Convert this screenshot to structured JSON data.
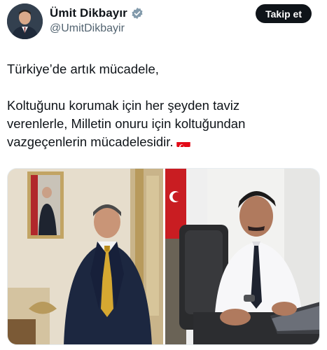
{
  "author": {
    "name": "Ümit Dikbayır",
    "handle": "@UmitDikbayir",
    "verified": true
  },
  "actions": {
    "follow_label": "Takip et"
  },
  "tweet": {
    "line1": "Türkiye’de artık mücadele,",
    "line2": "Koltuğunu korumak için her şeyden taviz",
    "line3": "verenlerle, Milletin onuru için koltuğundan",
    "line4": "vazgeçenlerin mücadelesidir.",
    "emoji": "turkey-flag"
  },
  "media": {
    "count": 2,
    "photos": [
      "man-in-suit-in-ornate-office-photo",
      "man-at-desk-with-laptop-photo"
    ]
  },
  "colors": {
    "follow_button_bg": "#0f1419",
    "verified_badge": "#829aab",
    "handle_text": "#536471",
    "flag_red": "#e30a17"
  }
}
